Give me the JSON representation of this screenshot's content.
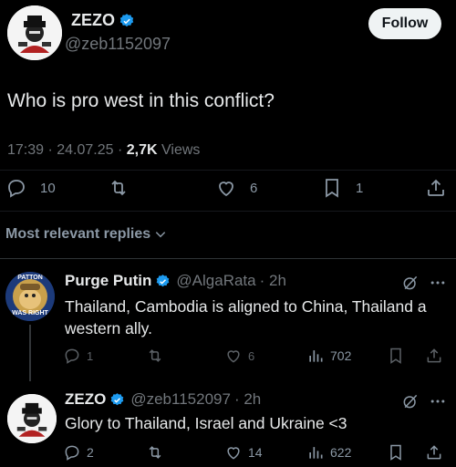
{
  "tweet": {
    "author_name": "ZEZO",
    "author_handle": "@zeb1152097",
    "follow_label": "Follow",
    "text": "Who is pro west in this conflict?",
    "time": "17:39 · 24.07.25 · ",
    "views_count": "2,7K",
    "views_label": " Views",
    "replies": "10",
    "likes": "6",
    "bookmarks": "1"
  },
  "replies_filter": {
    "label": "Most relevant replies"
  },
  "replies": [
    {
      "author_name": "Purge Putin",
      "author_handle": "@AlgaRata",
      "age": "· 2h",
      "avatar_text_top": "PATTON",
      "avatar_text_bottom": "WAS RIGHT",
      "text": "Thailand, Cambodia is aligned to China, Thailand a western ally.",
      "replies": "1",
      "likes": "6",
      "views": "702"
    },
    {
      "author_name": "ZEZO",
      "author_handle": "@zeb1152097",
      "age": "· 2h",
      "text": "Glory to Thailand, Israel and Ukraine <3",
      "replies": "2",
      "likes": "14",
      "views": "622"
    }
  ],
  "colors": {
    "background": "#000000",
    "verified": "#1d9bf0",
    "muted": "#71767b"
  }
}
